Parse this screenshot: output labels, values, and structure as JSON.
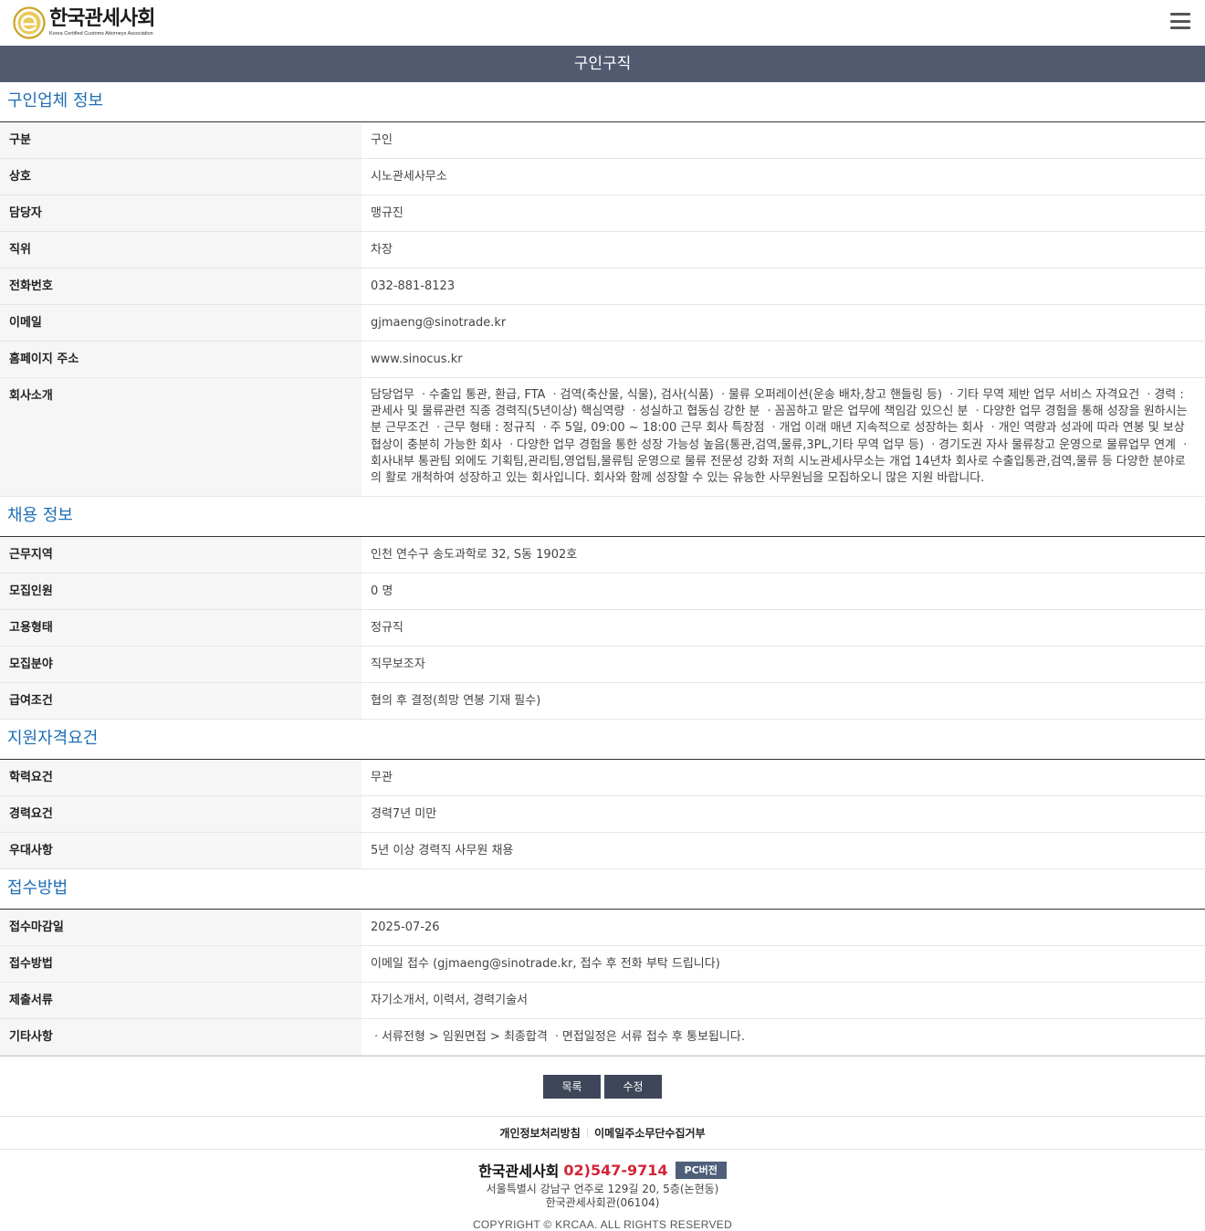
{
  "header": {
    "logo_kor": "한국관세사회",
    "logo_eng": "Korea Certified Customs Attorneys Association"
  },
  "page_title": "구인구직",
  "sections": {
    "company": {
      "title": "구인업체 정보",
      "rows": [
        {
          "label": "구분",
          "value": "구인"
        },
        {
          "label": "상호",
          "value": "시노관세사무소"
        },
        {
          "label": "담당자",
          "value": "맹규진"
        },
        {
          "label": "직위",
          "value": "차장"
        },
        {
          "label": "전화번호",
          "value": "032-881-8123"
        },
        {
          "label": "이메일",
          "value": "gjmaeng@sinotrade.kr"
        },
        {
          "label": "홈페이지 주소",
          "value": "www.sinocus.kr"
        },
        {
          "label": "회사소개",
          "value": "담당업무 ㆍ수출입 통관, 환급, FTA ㆍ검역(축산물, 식물), 검사(식품) ㆍ물류 오퍼레이션(운송 배차,창고 핸들링 등) ㆍ기타 무역 제반 업무 서비스 자격요건 ㆍ경력 : 관세사 및 물류관련 직종 경력직(5년이상) 핵심역량 ㆍ성실하고 협동심 강한 분 ㆍ꼼꼼하고 맡은 업무에 책임감 있으신 분 ㆍ다양한 업무 경험을 통해 성장을 원하시는 분 근무조건 ㆍ근무 형태 : 정규직 ㆍ주 5일, 09:00 ~ 18:00 근무 회사 특장점 ㆍ개업 이래 매년 지속적으로 성장하는 회사 ㆍ개인 역량과 성과에 따라 연봉 및 보상 협상이 충분히 가능한 회사 ㆍ다양한 업무 경험을 통한 성장 가능성 높음(통관,검역,물류,3PL,기타 무역 업무 등) ㆍ경기도권 자사 물류창고 운영으로 물류업무 연계 ㆍ회사내부 통관팀 외에도 기획팀,관리팀,영업팀,물류팀 운영으로 물류 전문성 강화 저희 시노관세사무소는 개업 14년차 회사로 수출입통관,검역,물류 등 다양한 분야로의 활로 개척하여 성장하고 있는 회사입니다. 회사와 함께 성장할 수 있는 유능한 사무원님을 모집하오니 많은 지원 바랍니다."
        }
      ]
    },
    "hiring": {
      "title": "채용 정보",
      "rows": [
        {
          "label": "근무지역",
          "value": "인천 연수구 송도과학로 32, S동 1902호"
        },
        {
          "label": "모집인원",
          "value": "0 명"
        },
        {
          "label": "고용형태",
          "value": "정규직"
        },
        {
          "label": "모집분야",
          "value": "직무보조자"
        },
        {
          "label": "급여조건",
          "value": "협의 후 결정(희망 연봉 기재 필수)"
        }
      ]
    },
    "qualification": {
      "title": "지원자격요건",
      "rows": [
        {
          "label": "학력요건",
          "value": "무관"
        },
        {
          "label": "경력요건",
          "value": "경력7년 미만"
        },
        {
          "label": "우대사항",
          "value": "5년 이상 경력직 사무원 채용"
        }
      ]
    },
    "apply": {
      "title": "접수방법",
      "rows": [
        {
          "label": "접수마감일",
          "value": "2025-07-26"
        },
        {
          "label": "접수방법",
          "value": "이메일 접수 (gjmaeng@sinotrade.kr, 접수 후 전화 부탁 드립니다)"
        },
        {
          "label": "제출서류",
          "value": "자기소개서, 이력서, 경력기술서"
        },
        {
          "label": "기타사항",
          "value": "ㆍ서류전형 > 임원면접 > 최종합격 ㆍ면접일정은 서류 접수 후 통보됩니다."
        }
      ]
    }
  },
  "buttons": {
    "list": "목록",
    "edit": "수정"
  },
  "footer": {
    "privacy": "개인정보처리방침",
    "email_policy": "이메일주소무단수집거부",
    "org_name": "한국관세사회",
    "phone": "02)547-9714",
    "pc_version": "PC버전",
    "address_line1": "서울특별시 강남구 언주로 129길 20, 5층(논현동)",
    "address_line2": "한국관세사회관(06104)",
    "copyright": "COPYRIGHT © KRCAA. ALL RIGHTS RESERVED"
  },
  "colors": {
    "title_bar": "#525a70",
    "section_title": "#1f6eb6",
    "button": "#3e4659",
    "phone": "#d42438",
    "logo_gold": "#c9a227"
  },
  "icons": {
    "logo": "krcaa-logo-icon",
    "menu": "hamburger-menu-icon"
  }
}
